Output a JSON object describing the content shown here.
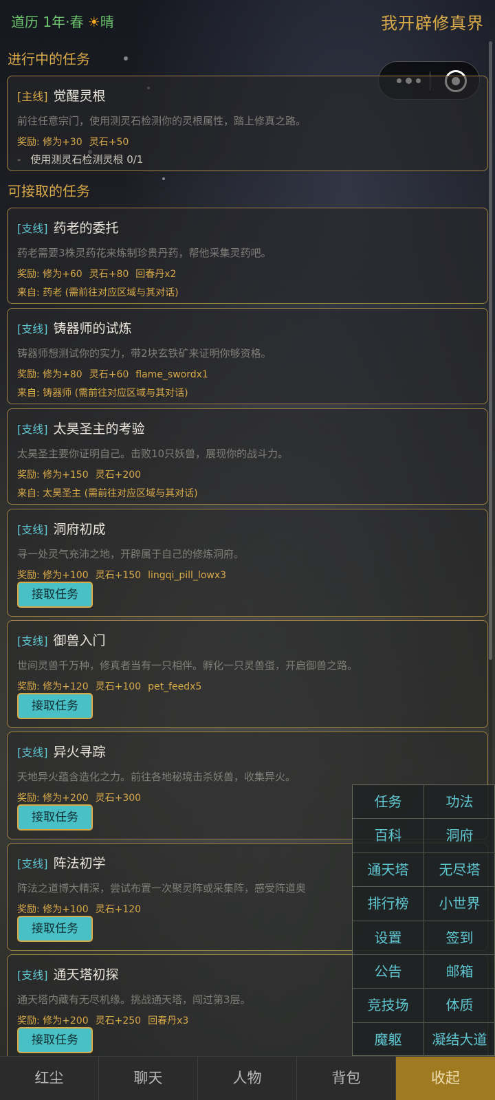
{
  "header": {
    "date_prefix": "道历 1年·春",
    "weather_icon": "sun-icon",
    "weather": "晴",
    "app_title": "我开辟修真界"
  },
  "capsule": {
    "more_icon": "more-dots-icon",
    "close_icon": "target-circle-icon"
  },
  "sections": {
    "in_progress": "进行中的任务",
    "available": "可接取的任务"
  },
  "main_quest": {
    "tag": "[主线]",
    "title": "觉醒灵根",
    "description": "前往任意宗门，使用测灵石检测你的灵根属性，踏上修真之路。",
    "rewards": [
      "奖励: 修为+30",
      "灵石+50"
    ],
    "objective_dash": "-",
    "objective": "使用测灵石检测灵根 0/1"
  },
  "quests": [
    {
      "tag": "[支线]",
      "title": "药老的委托",
      "description": "药老需要3株灵药花来炼制珍贵丹药，帮他采集灵药吧。",
      "rewards": [
        "奖励: 修为+60",
        "灵石+80",
        "回春丹x2"
      ],
      "from": "来自: 药老 (需前往对应区域与其对话)"
    },
    {
      "tag": "[支线]",
      "title": "铸器师的试炼",
      "description": "铸器师想测试你的实力，带2块玄铁矿来证明你够资格。",
      "rewards": [
        "奖励: 修为+80",
        "灵石+60",
        "flame_swordx1"
      ],
      "from": "来自: 铸器师 (需前往对应区域与其对话)"
    },
    {
      "tag": "[支线]",
      "title": "太昊圣主的考验",
      "description": "太昊圣主要你证明自己。击败10只妖兽，展现你的战斗力。",
      "rewards": [
        "奖励: 修为+150",
        "灵石+200"
      ],
      "from": "来自: 太昊圣主 (需前往对应区域与其对话)"
    },
    {
      "tag": "[支线]",
      "title": "洞府初成",
      "description": "寻一处灵气充沛之地，开辟属于自己的修炼洞府。",
      "rewards": [
        "奖励: 修为+100",
        "灵石+150",
        "lingqi_pill_lowx3"
      ],
      "button": "接取任务"
    },
    {
      "tag": "[支线]",
      "title": "御兽入门",
      "description": "世间灵兽千万种，修真者当有一只相伴。孵化一只灵兽蛋，开启御兽之路。",
      "rewards": [
        "奖励: 修为+120",
        "灵石+100",
        "pet_feedx5"
      ],
      "button": "接取任务"
    },
    {
      "tag": "[支线]",
      "title": "异火寻踪",
      "description": "天地异火蕴含造化之力。前往各地秘境击杀妖兽，收集异火。",
      "rewards": [
        "奖励: 修为+200",
        "灵石+300"
      ],
      "button": "接取任务"
    },
    {
      "tag": "[支线]",
      "title": "阵法初学",
      "description": "阵法之道博大精深，尝试布置一次聚灵阵或采集阵，感受阵道奥",
      "rewards": [
        "奖励: 修为+100",
        "灵石+120"
      ],
      "button": "接取任务"
    },
    {
      "tag": "[支线]",
      "title": "通天塔初探",
      "description": "通天塔内藏有无尽机缘。挑战通天塔，闯过第3层。",
      "rewards": [
        "奖励: 修为+200",
        "灵石+250",
        "回春丹x3"
      ],
      "button": "接取任务"
    }
  ],
  "quick_menu": [
    "任务",
    "功法",
    "百科",
    "洞府",
    "通天塔",
    "无尽塔",
    "排行榜",
    "小世界",
    "设置",
    "签到",
    "公告",
    "邮箱",
    "竞技场",
    "体质",
    "魔躯",
    "凝结大道"
  ],
  "bottom_nav": [
    "红尘",
    "聊天",
    "人物",
    "背包",
    "收起"
  ],
  "colors": {
    "gold": "#d8a948",
    "teal": "#5fc6d2",
    "green_date": "#6cc46c",
    "active_nav": "#a07a21"
  }
}
